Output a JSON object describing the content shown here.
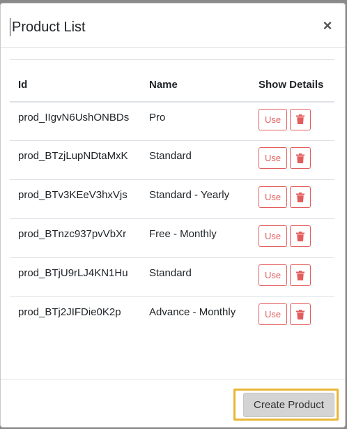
{
  "modal": {
    "title": "Product List",
    "close_label": "×"
  },
  "table": {
    "headers": {
      "id": "Id",
      "name": "Name",
      "show_details": "Show Details"
    },
    "rows": [
      {
        "id": "prod_IIgvN6UshONBDs",
        "name": "Pro"
      },
      {
        "id": "prod_BTzjLupNDtaMxK",
        "name": "Standard"
      },
      {
        "id": "prod_BTv3KEeV3hxVjs",
        "name": "Standard - Yearly"
      },
      {
        "id": "prod_BTnzc937pvVbXr",
        "name": "Free - Monthly"
      },
      {
        "id": "prod_BTjU9rLJ4KN1Hu",
        "name": "Standard"
      },
      {
        "id": "prod_BTj2JIFDie0K2p",
        "name": "Advance - Monthly"
      }
    ],
    "use_label": "Use",
    "delete_icon": "trash-icon"
  },
  "footer": {
    "create_label": "Create Product"
  },
  "colors": {
    "danger": "#e35d5d",
    "highlight": "#e9b638",
    "create_bg": "#d4d4d4"
  }
}
